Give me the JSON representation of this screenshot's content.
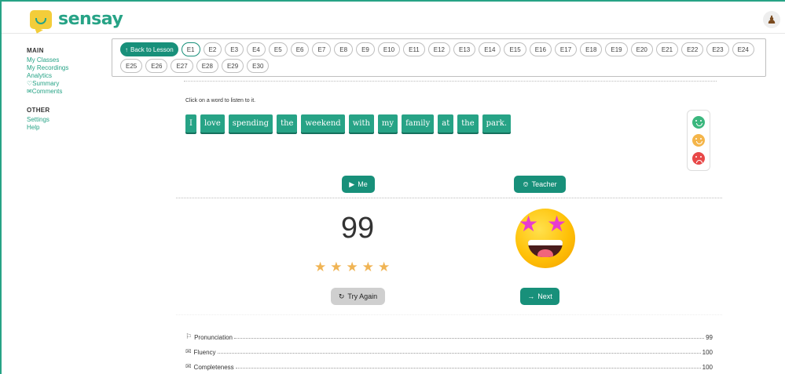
{
  "app": {
    "brand": "sensay"
  },
  "sidebar": {
    "main_title": "MAIN",
    "main_items": [
      "My Classes",
      "My Recordings",
      "Analytics",
      "Summary",
      "Comments"
    ],
    "other_title": "OTHER",
    "other_items": [
      "Settings",
      "Help"
    ]
  },
  "exercises": {
    "back_label": "Back to Lesson",
    "active": "E1",
    "row1": [
      "E1",
      "E2",
      "E3",
      "E4",
      "E5",
      "E6",
      "E7",
      "E8",
      "E9",
      "E10",
      "E11",
      "E12",
      "E13",
      "E14",
      "E15",
      "E16",
      "E17",
      "E18",
      "E19",
      "E20",
      "E21",
      "E22",
      "E23",
      "E24"
    ],
    "row2": [
      "E25",
      "E26",
      "E27",
      "E28",
      "E29",
      "E30"
    ]
  },
  "sentence": {
    "instruction": "Click on a word to listen to it.",
    "words": [
      "I",
      "love",
      "spending",
      "the",
      "weekend",
      "with",
      "my",
      "family",
      "at",
      "the",
      "park."
    ]
  },
  "controls": {
    "me_label": "Me",
    "teacher_label": "Teacher",
    "try_again_label": "Try Again",
    "next_label": "Next"
  },
  "result": {
    "score": "99",
    "stars": 5
  },
  "metrics": [
    {
      "label": "Pronunciation",
      "value": "99",
      "icon": "flag-icon"
    },
    {
      "label": "Fluency",
      "value": "100",
      "icon": "speech-bubble-icon"
    },
    {
      "label": "Completeness",
      "value": "100",
      "icon": "speech-bubble-icon"
    }
  ],
  "colors": {
    "accent": "#18907a",
    "word_bg": "#27a386",
    "star": "#f0b454"
  }
}
